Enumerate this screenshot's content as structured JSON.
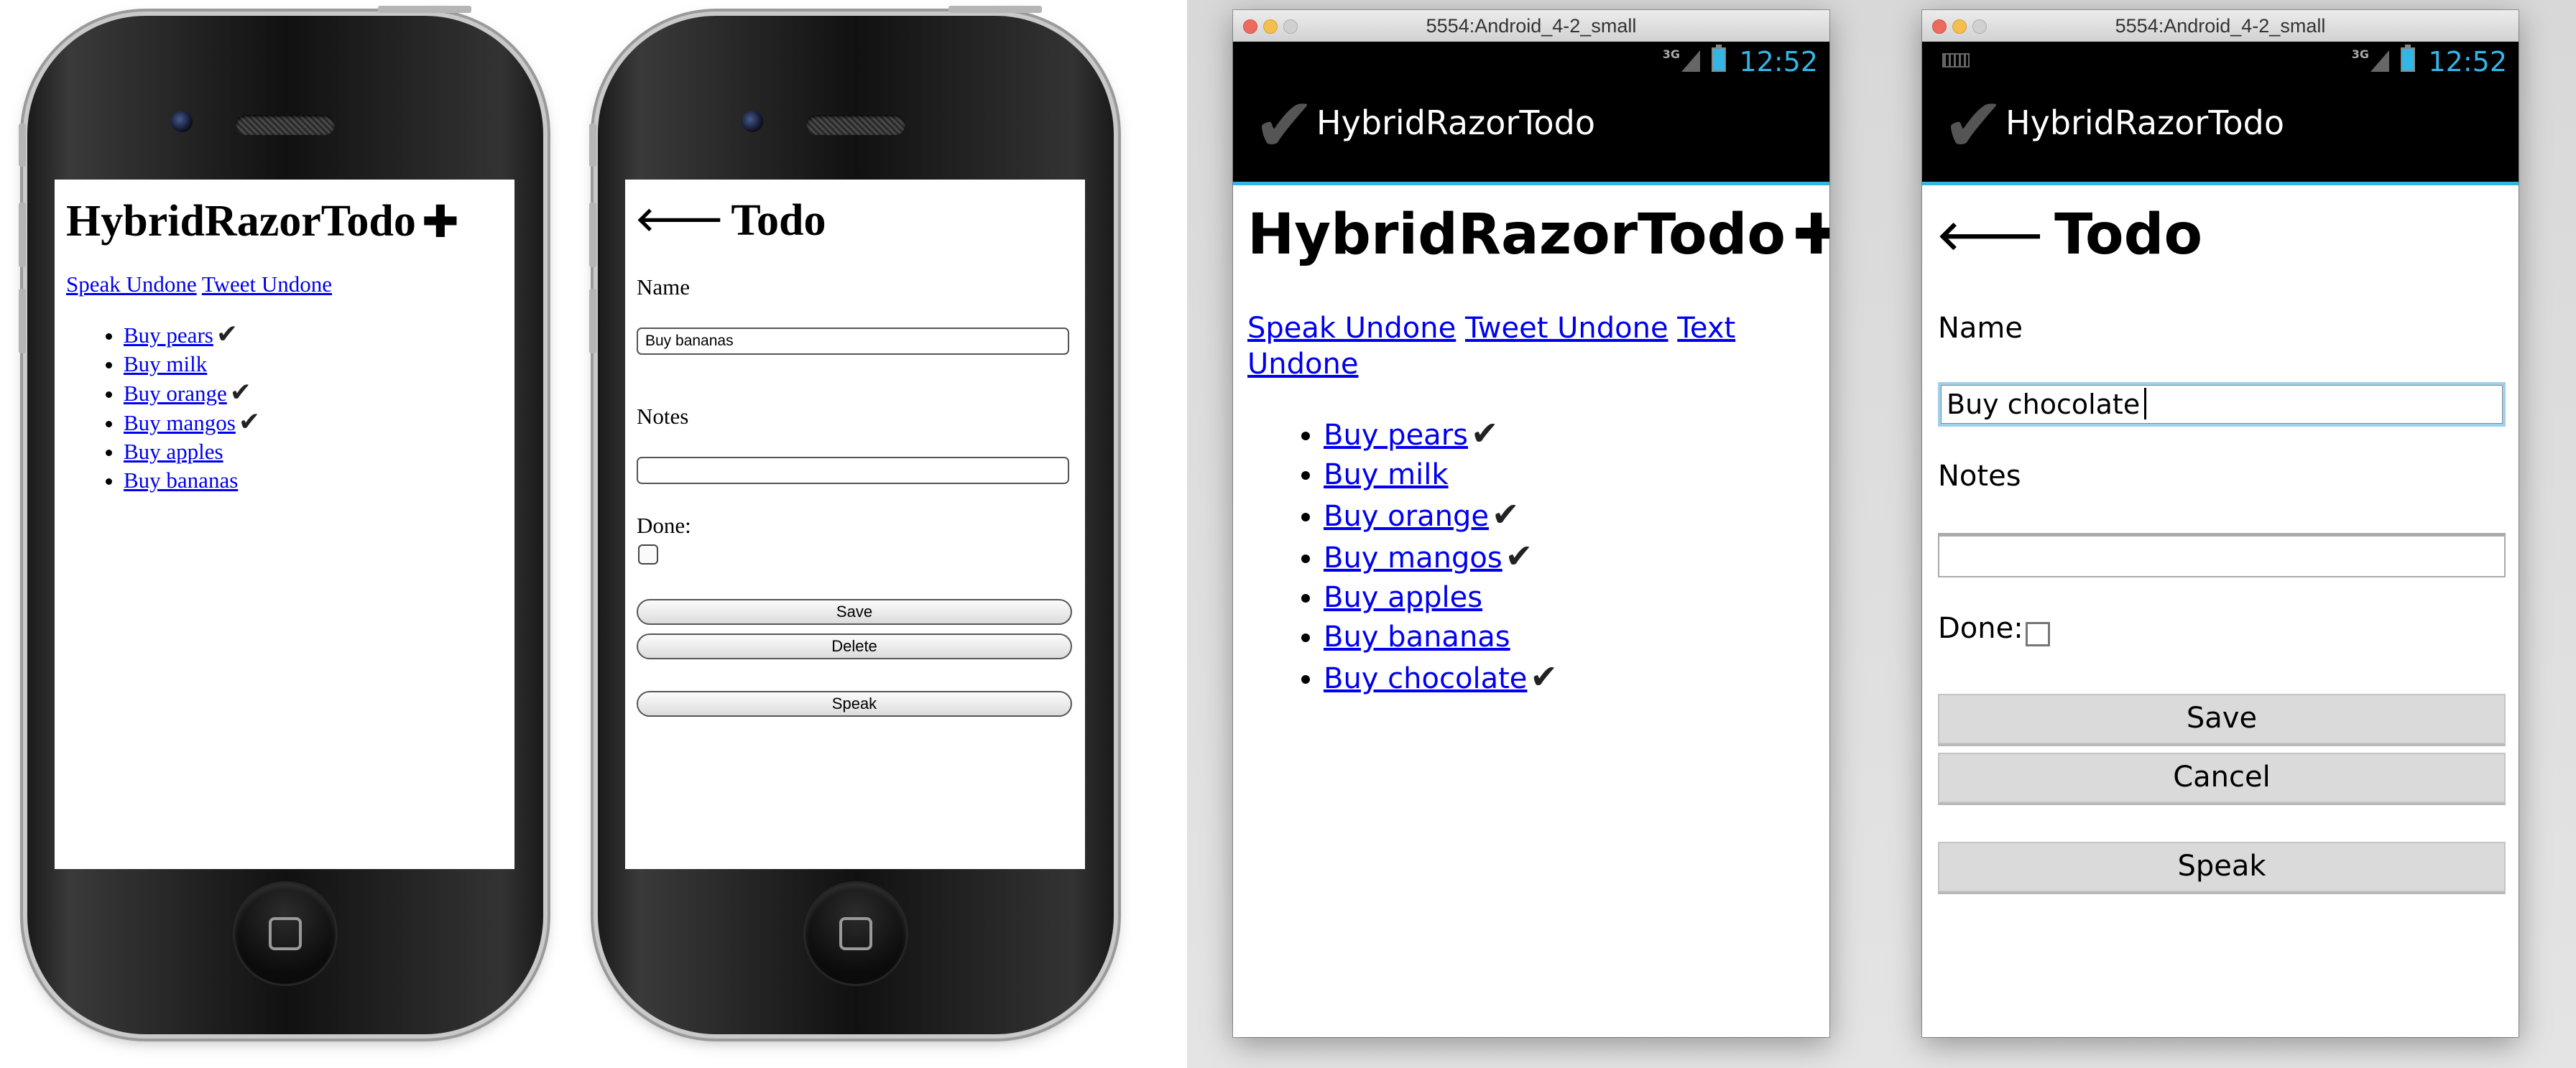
{
  "ios": {
    "list_screen": {
      "title": "HybridRazorTodo",
      "add_icon": "plus-icon",
      "links": [
        "Speak Undone",
        "Tweet Undone"
      ],
      "items": [
        {
          "label": "Buy pears",
          "done": true
        },
        {
          "label": "Buy milk",
          "done": false
        },
        {
          "label": "Buy orange",
          "done": true
        },
        {
          "label": "Buy mangos",
          "done": true
        },
        {
          "label": "Buy apples",
          "done": false
        },
        {
          "label": "Buy bananas",
          "done": false
        }
      ]
    },
    "edit_screen": {
      "title": "Todo",
      "back_icon": "back-arrow-icon",
      "name_label": "Name",
      "name_value": "Buy bananas",
      "notes_label": "Notes",
      "notes_value": "",
      "done_label": "Done:",
      "done_checked": false,
      "save_label": "Save",
      "delete_label": "Delete",
      "speak_label": "Speak"
    }
  },
  "android": {
    "window_title": "5554:Android_4-2_small",
    "status": {
      "time": "12:52",
      "network": "3G"
    },
    "app_title": "HybridRazorTodo",
    "app_icon": "check-icon",
    "list_screen": {
      "title": "HybridRazorTodo",
      "add_icon": "plus-icon",
      "links": [
        "Speak Undone",
        "Tweet Undone",
        "Text Undone"
      ],
      "items": [
        {
          "label": "Buy pears",
          "done": true
        },
        {
          "label": "Buy milk",
          "done": false
        },
        {
          "label": "Buy orange",
          "done": true
        },
        {
          "label": "Buy mangos",
          "done": true
        },
        {
          "label": "Buy apples",
          "done": false
        },
        {
          "label": "Buy bananas",
          "done": false
        },
        {
          "label": "Buy chocolate",
          "done": true
        }
      ]
    },
    "edit_screen": {
      "title": "Todo",
      "back_icon": "back-arrow-icon",
      "name_label": "Name",
      "name_value": "Buy chocolate",
      "notes_label": "Notes",
      "notes_value": "",
      "done_label": "Done:",
      "done_checked": false,
      "save_label": "Save",
      "cancel_label": "Cancel",
      "speak_label": "Speak"
    }
  },
  "colors": {
    "link": "#0000ee",
    "android_accent": "#33b5e5",
    "check": "#222222"
  }
}
